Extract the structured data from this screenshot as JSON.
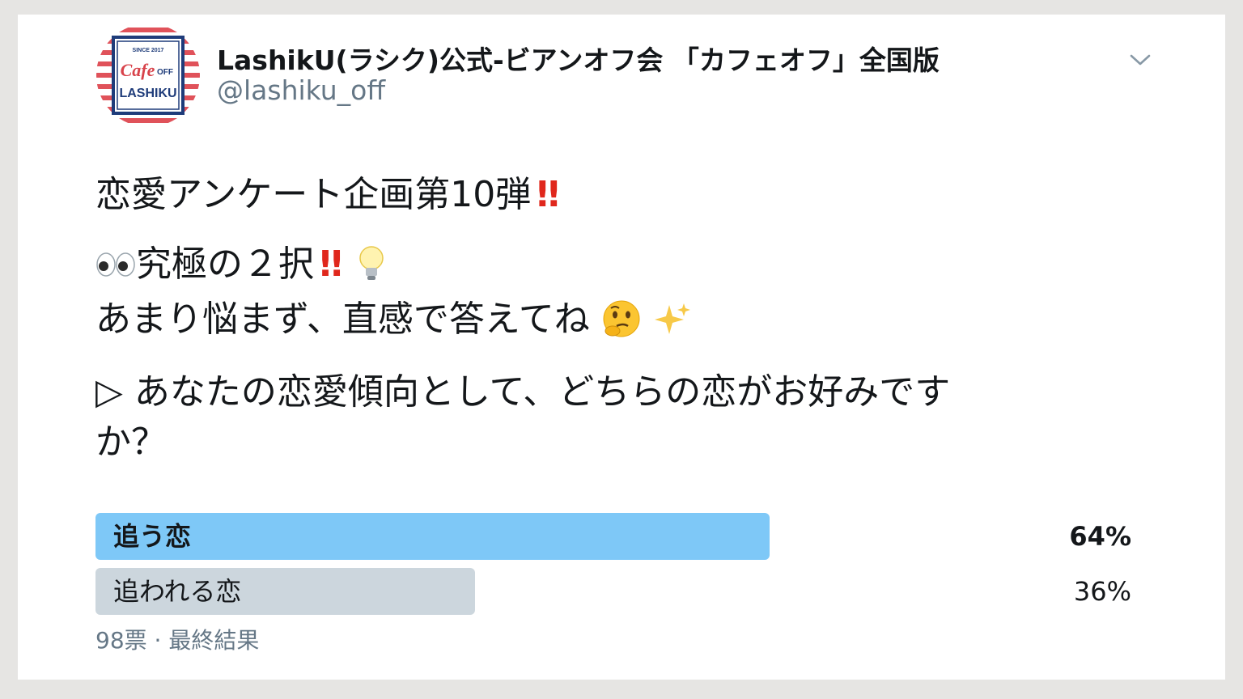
{
  "account": {
    "display_name": "LashikU(ラシク)公式-ビアンオフ会 「カフェオフ」全国版",
    "handle": "@lashiku_off",
    "avatar": {
      "since": "SINCE 2017",
      "cafe": "Cafe",
      "off": "OFF",
      "brand": "LASHIKU"
    }
  },
  "tweet": {
    "line1": "恋愛アンケート企画第10弾",
    "line2": "究極の２択",
    "line3": "あまり悩まず、直感で答えてね",
    "line4": "▷ あなたの恋愛傾向として、どちらの恋がお好みです",
    "line5": "か？"
  },
  "poll": {
    "options": [
      {
        "label": "追う恋",
        "percent_text": "64%",
        "percent": 64,
        "winner": true,
        "color": "#7ec8f7"
      },
      {
        "label": "追われる恋",
        "percent_text": "36%",
        "percent": 36,
        "winner": false,
        "color": "#ccd6dd"
      }
    ],
    "votes_text": "98票 · 最終結果"
  },
  "icons": [
    "chevron-down-icon",
    "eyes-icon",
    "double-exclamation-icon",
    "light-bulb-icon",
    "thinking-face-icon",
    "sparkles-icon"
  ]
}
